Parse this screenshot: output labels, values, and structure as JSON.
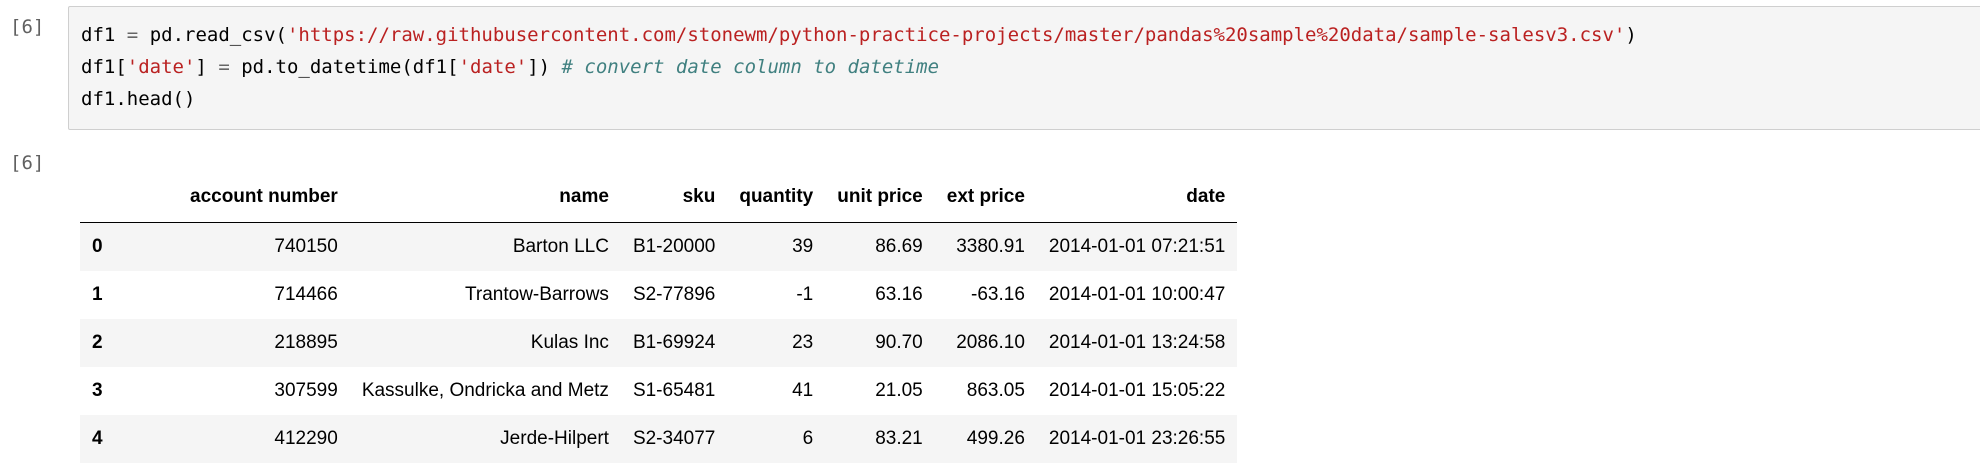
{
  "input_prompt": "[6]",
  "output_prompt": "[6]",
  "code": {
    "line1": {
      "var": "df1",
      "eq": "=",
      "call": "pd.read_csv(",
      "str": "'https://raw.githubusercontent.com/stonewm/python-practice-projects/master/pandas%20sample%20data/sample-salesv3.csv'",
      "close": ")"
    },
    "line2": {
      "lhs": "df1[",
      "key1": "'date'",
      "mid": "]",
      "eq": "=",
      "call": "pd.to_datetime(df1[",
      "key2": "'date'",
      "close": "])",
      "comment": "# convert date column to datetime"
    },
    "line3": "df1.head()"
  },
  "table": {
    "columns": [
      "account number",
      "name",
      "sku",
      "quantity",
      "unit price",
      "ext price",
      "date"
    ],
    "rows": [
      {
        "index": "0",
        "account_number": "740150",
        "name": "Barton LLC",
        "sku": "B1-20000",
        "quantity": "39",
        "unit_price": "86.69",
        "ext_price": "3380.91",
        "date": "2014-01-01 07:21:51"
      },
      {
        "index": "1",
        "account_number": "714466",
        "name": "Trantow-Barrows",
        "sku": "S2-77896",
        "quantity": "-1",
        "unit_price": "63.16",
        "ext_price": "-63.16",
        "date": "2014-01-01 10:00:47"
      },
      {
        "index": "2",
        "account_number": "218895",
        "name": "Kulas Inc",
        "sku": "B1-69924",
        "quantity": "23",
        "unit_price": "90.70",
        "ext_price": "2086.10",
        "date": "2014-01-01 13:24:58"
      },
      {
        "index": "3",
        "account_number": "307599",
        "name": "Kassulke, Ondricka and Metz",
        "sku": "S1-65481",
        "quantity": "41",
        "unit_price": "21.05",
        "ext_price": "863.05",
        "date": "2014-01-01 15:05:22"
      },
      {
        "index": "4",
        "account_number": "412290",
        "name": "Jerde-Hilpert",
        "sku": "S2-34077",
        "quantity": "6",
        "unit_price": "83.21",
        "ext_price": "499.26",
        "date": "2014-01-01 23:26:55"
      }
    ]
  }
}
